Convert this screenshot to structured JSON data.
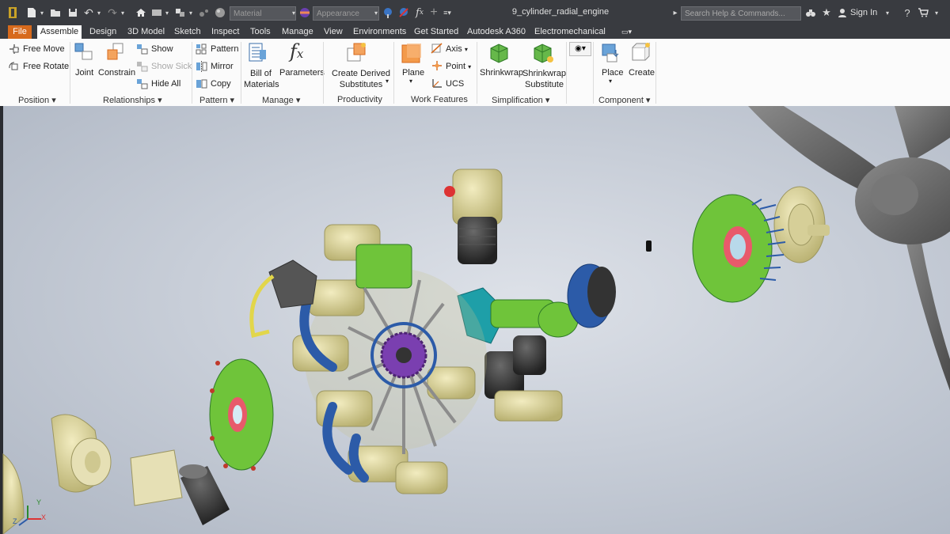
{
  "title_bar": {
    "document_title": "9_cylinder_radial_engine",
    "material_placeholder": "Material",
    "appearance_placeholder": "Appearance",
    "help_search_placeholder": "Search Help & Commands...",
    "signin_label": "Sign In",
    "icons": [
      "app-logo-icon",
      "new-icon",
      "open-icon",
      "save-icon",
      "undo-icon",
      "redo-icon",
      "home-icon",
      "return-icon",
      "select-icon",
      "update-icon",
      "material-sphere-icon",
      "appearance-icon",
      "clear-appearance-icon",
      "fx-icon",
      "plus-icon",
      "more-icon",
      "search-icon",
      "binoculars-icon",
      "star-icon",
      "user-icon",
      "help-icon",
      "cart-icon"
    ]
  },
  "tabs": [
    {
      "label": "File"
    },
    {
      "label": "Assemble"
    },
    {
      "label": "Design"
    },
    {
      "label": "3D Model"
    },
    {
      "label": "Sketch"
    },
    {
      "label": "Inspect"
    },
    {
      "label": "Tools"
    },
    {
      "label": "Manage"
    },
    {
      "label": "View"
    },
    {
      "label": "Environments"
    },
    {
      "label": "Get Started"
    },
    {
      "label": "Autodesk A360"
    },
    {
      "label": "Electromechanical"
    }
  ],
  "ribbon": {
    "position": {
      "label": "Position",
      "free_move": "Free Move",
      "free_rotate": "Free Rotate"
    },
    "relationships": {
      "label": "Relationships",
      "joint": "Joint",
      "constrain": "Constrain",
      "show": "Show",
      "show_sick": "Show Sick",
      "hide_all": "Hide All"
    },
    "pattern": {
      "label": "Pattern",
      "pattern": "Pattern",
      "mirror": "Mirror",
      "copy": "Copy"
    },
    "manage": {
      "label": "Manage",
      "bom_line1": "Bill of",
      "bom_line2": "Materials",
      "parameters": "Parameters"
    },
    "productivity": {
      "label": "Productivity",
      "derived_line1": "Create Derived",
      "derived_line2": "Substitutes"
    },
    "work_features": {
      "label": "Work Features",
      "plane": "Plane",
      "axis": "Axis",
      "point": "Point",
      "ucs": "UCS"
    },
    "simplification": {
      "label": "Simplification",
      "shrinkwrap": "Shrinkwrap",
      "shrinkwrap_sub_line1": "Shrinkwrap",
      "shrinkwrap_sub_line2": "Substitute"
    },
    "component": {
      "label": "Component",
      "place": "Place",
      "create": "Create"
    }
  },
  "viewport": {
    "axis_labels": {
      "x": "X",
      "y": "Y",
      "z": "Z"
    },
    "colors": {
      "brass": "#d8d29a",
      "green": "#6fc43a",
      "blue": "#2c5ba8",
      "purple": "#7a3fb0",
      "dark": "#3a3a3a",
      "teal": "#1e9fa8",
      "propeller": "#6e6e6e"
    }
  }
}
